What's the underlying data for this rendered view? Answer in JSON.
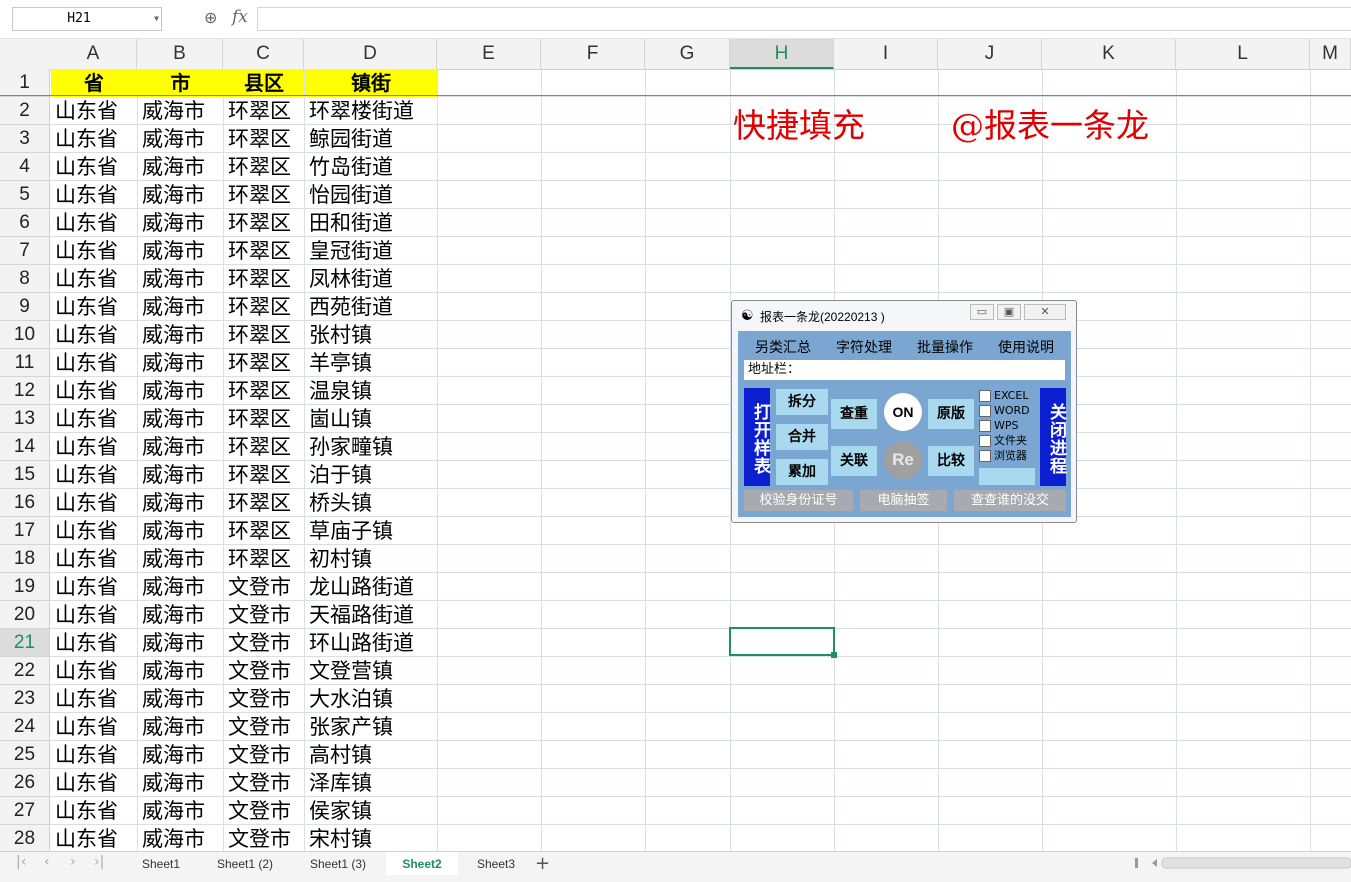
{
  "namebox": {
    "value": "H21",
    "zoom_icon": "magnifier-icon",
    "fx": "fx"
  },
  "columns": [
    "A",
    "B",
    "C",
    "D",
    "E",
    "F",
    "G",
    "H",
    "I",
    "J",
    "K",
    "L",
    "M"
  ],
  "selected_column": "H",
  "selected_row": "21",
  "header_row": [
    "省",
    "市",
    "县区",
    "镇街"
  ],
  "rows": [
    [
      "2",
      "山东省",
      "威海市",
      "环翠区",
      "环翠楼街道"
    ],
    [
      "3",
      "山东省",
      "威海市",
      "环翠区",
      "鲸园街道"
    ],
    [
      "4",
      "山东省",
      "威海市",
      "环翠区",
      "竹岛街道"
    ],
    [
      "5",
      "山东省",
      "威海市",
      "环翠区",
      "怡园街道"
    ],
    [
      "6",
      "山东省",
      "威海市",
      "环翠区",
      "田和街道"
    ],
    [
      "7",
      "山东省",
      "威海市",
      "环翠区",
      "皇冠街道"
    ],
    [
      "8",
      "山东省",
      "威海市",
      "环翠区",
      "凤林街道"
    ],
    [
      "9",
      "山东省",
      "威海市",
      "环翠区",
      "西苑街道"
    ],
    [
      "10",
      "山东省",
      "威海市",
      "环翠区",
      "张村镇"
    ],
    [
      "11",
      "山东省",
      "威海市",
      "环翠区",
      "羊亭镇"
    ],
    [
      "12",
      "山东省",
      "威海市",
      "环翠区",
      "温泉镇"
    ],
    [
      "13",
      "山东省",
      "威海市",
      "环翠区",
      "崮山镇"
    ],
    [
      "14",
      "山东省",
      "威海市",
      "环翠区",
      "孙家疃镇"
    ],
    [
      "15",
      "山东省",
      "威海市",
      "环翠区",
      "泊于镇"
    ],
    [
      "16",
      "山东省",
      "威海市",
      "环翠区",
      "桥头镇"
    ],
    [
      "17",
      "山东省",
      "威海市",
      "环翠区",
      "草庙子镇"
    ],
    [
      "18",
      "山东省",
      "威海市",
      "环翠区",
      "初村镇"
    ],
    [
      "19",
      "山东省",
      "威海市",
      "文登市",
      "龙山路街道"
    ],
    [
      "20",
      "山东省",
      "威海市",
      "文登市",
      "天福路街道"
    ],
    [
      "21",
      "山东省",
      "威海市",
      "文登市",
      "环山路街道"
    ],
    [
      "22",
      "山东省",
      "威海市",
      "文登市",
      "文登营镇"
    ],
    [
      "23",
      "山东省",
      "威海市",
      "文登市",
      "大水泊镇"
    ],
    [
      "24",
      "山东省",
      "威海市",
      "文登市",
      "张家产镇"
    ],
    [
      "25",
      "山东省",
      "威海市",
      "文登市",
      "高村镇"
    ],
    [
      "26",
      "山东省",
      "威海市",
      "文登市",
      "泽库镇"
    ],
    [
      "27",
      "山东省",
      "威海市",
      "文登市",
      "侯家镇"
    ],
    [
      "28",
      "山东省",
      "威海市",
      "文登市",
      "宋村镇"
    ]
  ],
  "banner": {
    "left": "快捷填充",
    "right": "@报表一条龙",
    "color": "#e00000"
  },
  "tool_window": {
    "title": "报表一条龙(20220213 )",
    "title_icon": "yin-yang-icon",
    "controls": [
      "▭",
      "▣",
      "✕"
    ],
    "menu": [
      "另类汇总",
      "字符处理",
      "批量操作",
      "使用说明"
    ],
    "address_label": "地址栏：",
    "open_sample": "打开样表",
    "close_process": "关闭进程",
    "buttons": {
      "split": "拆分",
      "merge": "合并",
      "accumulate": "累加",
      "dedupe": "查重",
      "link": "关联",
      "on": "ON",
      "re": "Re",
      "original": "原版",
      "compare": "比较"
    },
    "checkboxes": [
      "EXCEL",
      "WORD",
      "WPS",
      "文件夹",
      "浏览器"
    ],
    "bottom": [
      "校验身份证号",
      "电脑抽签",
      "查查谁的没交"
    ]
  },
  "sheets": [
    "Sheet1",
    "Sheet1 (2)",
    "Sheet1 (3)",
    "Sheet2",
    "Sheet3"
  ],
  "active_sheet": "Sheet2",
  "add_sheet": "+"
}
